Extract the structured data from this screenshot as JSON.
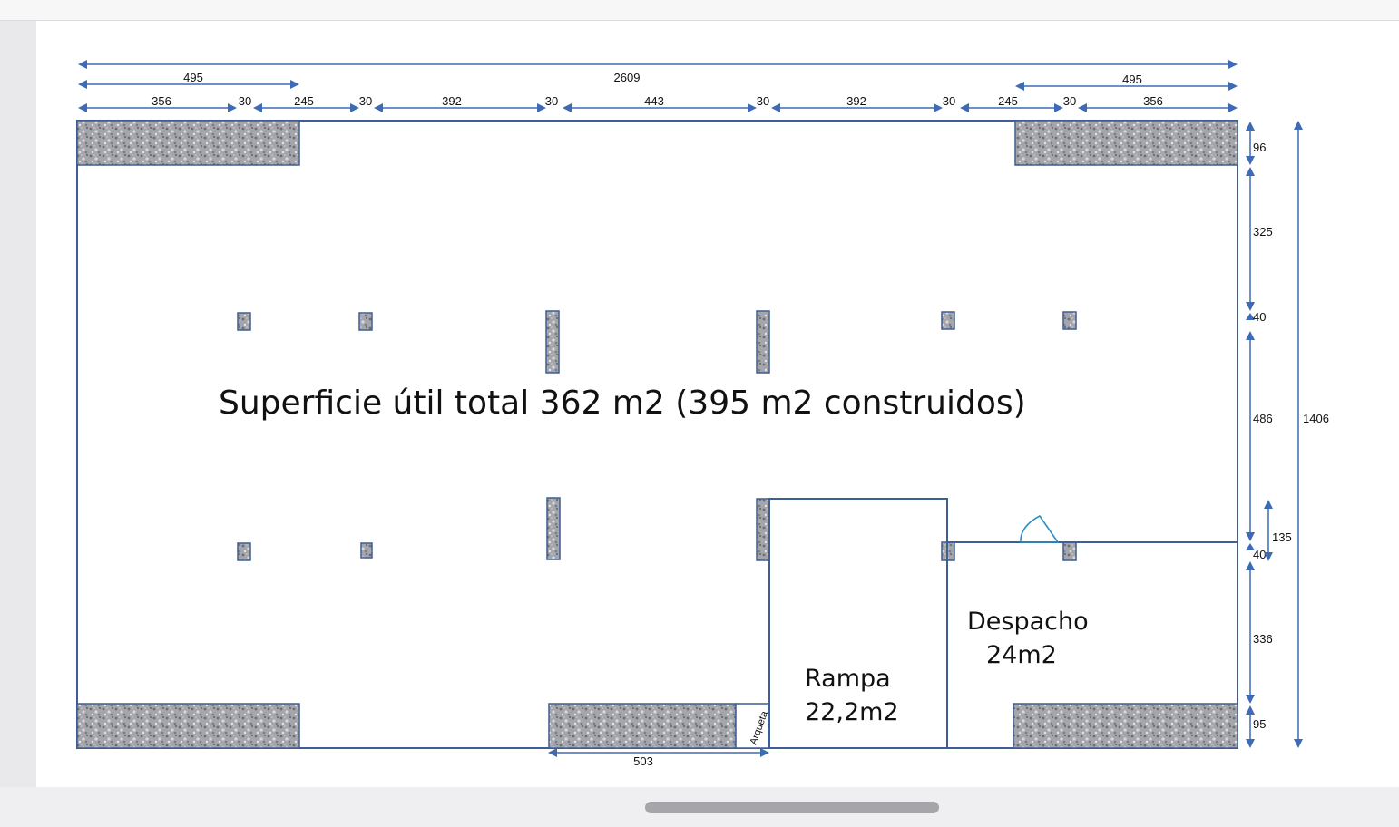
{
  "main_label": "Superficie útil total 362 m2 (395 m2 construidos)",
  "rooms": {
    "rampa": {
      "name": "Rampa",
      "area": "22,2m2"
    },
    "despacho": {
      "name": "Despacho",
      "area": "24m2"
    },
    "arqueta": "Arqueta"
  },
  "dimensions": {
    "overall_width": "2609",
    "top_left_span": "495",
    "top_right_span": "495",
    "top_segments": [
      "356",
      "30",
      "245",
      "30",
      "392",
      "30",
      "443",
      "30",
      "392",
      "30",
      "245",
      "30",
      "356"
    ],
    "right_vertical": [
      "96",
      "325",
      "40",
      "486",
      "40",
      "336",
      "95"
    ],
    "overall_height": "1406",
    "despacho_offset": "135",
    "bottom_span": "503"
  },
  "colors": {
    "line": "#3f5f93",
    "arrow": "#3d6bb5",
    "hatch": "#9a9ca2",
    "door": "#2a8fbf",
    "text": "#111111"
  }
}
